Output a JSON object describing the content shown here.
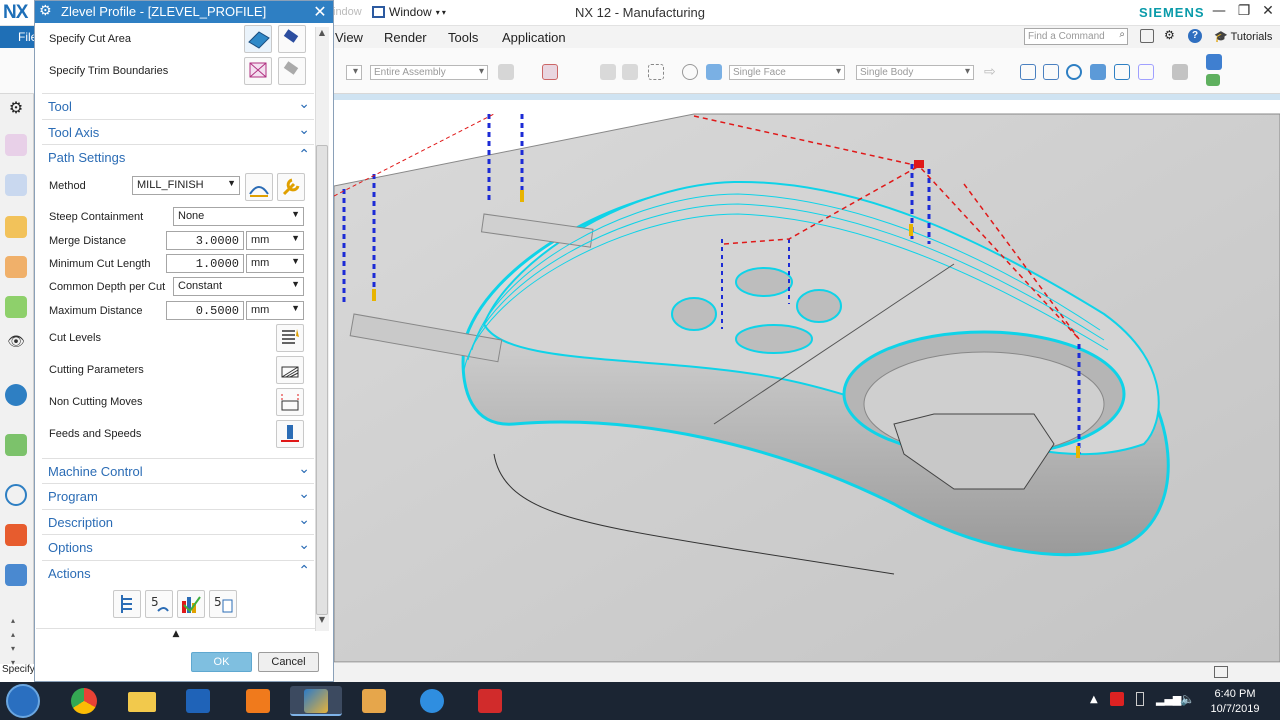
{
  "app": {
    "logo": "NX",
    "title": "NX 12 - Manufacturing",
    "ghost_menu": "indow",
    "window_menu": "Window",
    "brand": "SIEMENS",
    "file_tab": "File",
    "menu": [
      "View",
      "Render",
      "Tools",
      "Application"
    ],
    "find_placeholder": "Find a Command",
    "tutorials": "Tutorials",
    "status_left": "Specify"
  },
  "toolbar": {
    "assembly_filter": "Entire Assembly",
    "face_rule": "Single Face",
    "body_rule": "Single Body"
  },
  "dialog": {
    "title": "Zlevel Profile - [ZLEVEL_PROFILE]",
    "geometry": {
      "specify_cut_area": "Specify Cut Area",
      "specify_trim_boundaries": "Specify Trim Boundaries"
    },
    "sections": {
      "tool": "Tool",
      "tool_axis": "Tool Axis",
      "path_settings": "Path Settings",
      "machine_control": "Machine Control",
      "program": "Program",
      "description": "Description",
      "options": "Options",
      "actions": "Actions"
    },
    "path_settings": {
      "method_label": "Method",
      "method_value": "MILL_FINISH",
      "steep_label": "Steep Containment",
      "steep_value": "None",
      "merge_label": "Merge Distance",
      "merge_value": "3.0000",
      "merge_unit": "mm",
      "min_cut_label": "Minimum Cut Length",
      "min_cut_value": "1.0000",
      "min_cut_unit": "mm",
      "depth_label": "Common Depth per Cut",
      "depth_value": "Constant",
      "max_dist_label": "Maximum Distance",
      "max_dist_value": "0.5000",
      "max_dist_unit": "mm",
      "cut_levels": "Cut Levels",
      "cutting_parameters": "Cutting Parameters",
      "non_cutting_moves": "Non Cutting Moves",
      "feeds_speeds": "Feeds and Speeds"
    },
    "ok": "OK",
    "cancel": "Cancel"
  },
  "taskbar": {
    "time": "6:40 PM",
    "date": "10/7/2019"
  },
  "colors": {
    "accent": "#2e7fc3",
    "section_text": "#2b6cb5",
    "toolpath_cyan": "#19d3e6",
    "feed_blue": "#1c2bd6",
    "rapid_red": "#e01818"
  }
}
